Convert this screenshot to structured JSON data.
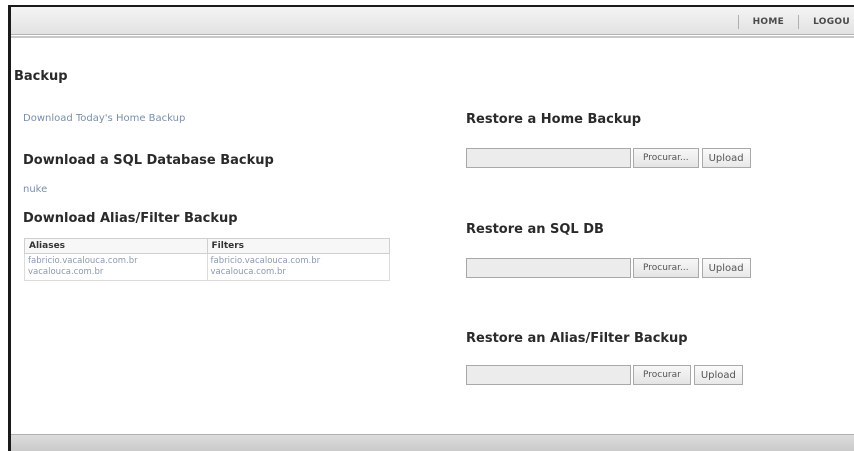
{
  "topnav": {
    "home_label": "HOME",
    "logout_label": "LOGOU"
  },
  "page": {
    "title": "Backup"
  },
  "left": {
    "today_link": "Download Today's Home Backup",
    "sql_heading": "Download a SQL Database Backup",
    "sql_db": "nuke",
    "alias_heading": "Download Alias/Filter Backup",
    "table": {
      "headers": [
        "Aliases",
        "Filters"
      ],
      "aliases": [
        "fabricio.vacalouca.com.br",
        "vacalouca.com.br"
      ],
      "filters": [
        "fabricio.vacalouca.com.br",
        "vacalouca.com.br"
      ]
    }
  },
  "right": {
    "restore_home": {
      "heading": "Restore a Home Backup",
      "browse_label": "Procurar...",
      "upload_label": "Upload"
    },
    "restore_sql": {
      "heading": "Restore an SQL DB",
      "browse_label": "Procurar...",
      "upload_label": "Upload"
    },
    "restore_alias": {
      "heading": "Restore an Alias/Filter Backup",
      "browse_label": "Procurar",
      "upload_label": "Upload"
    }
  }
}
